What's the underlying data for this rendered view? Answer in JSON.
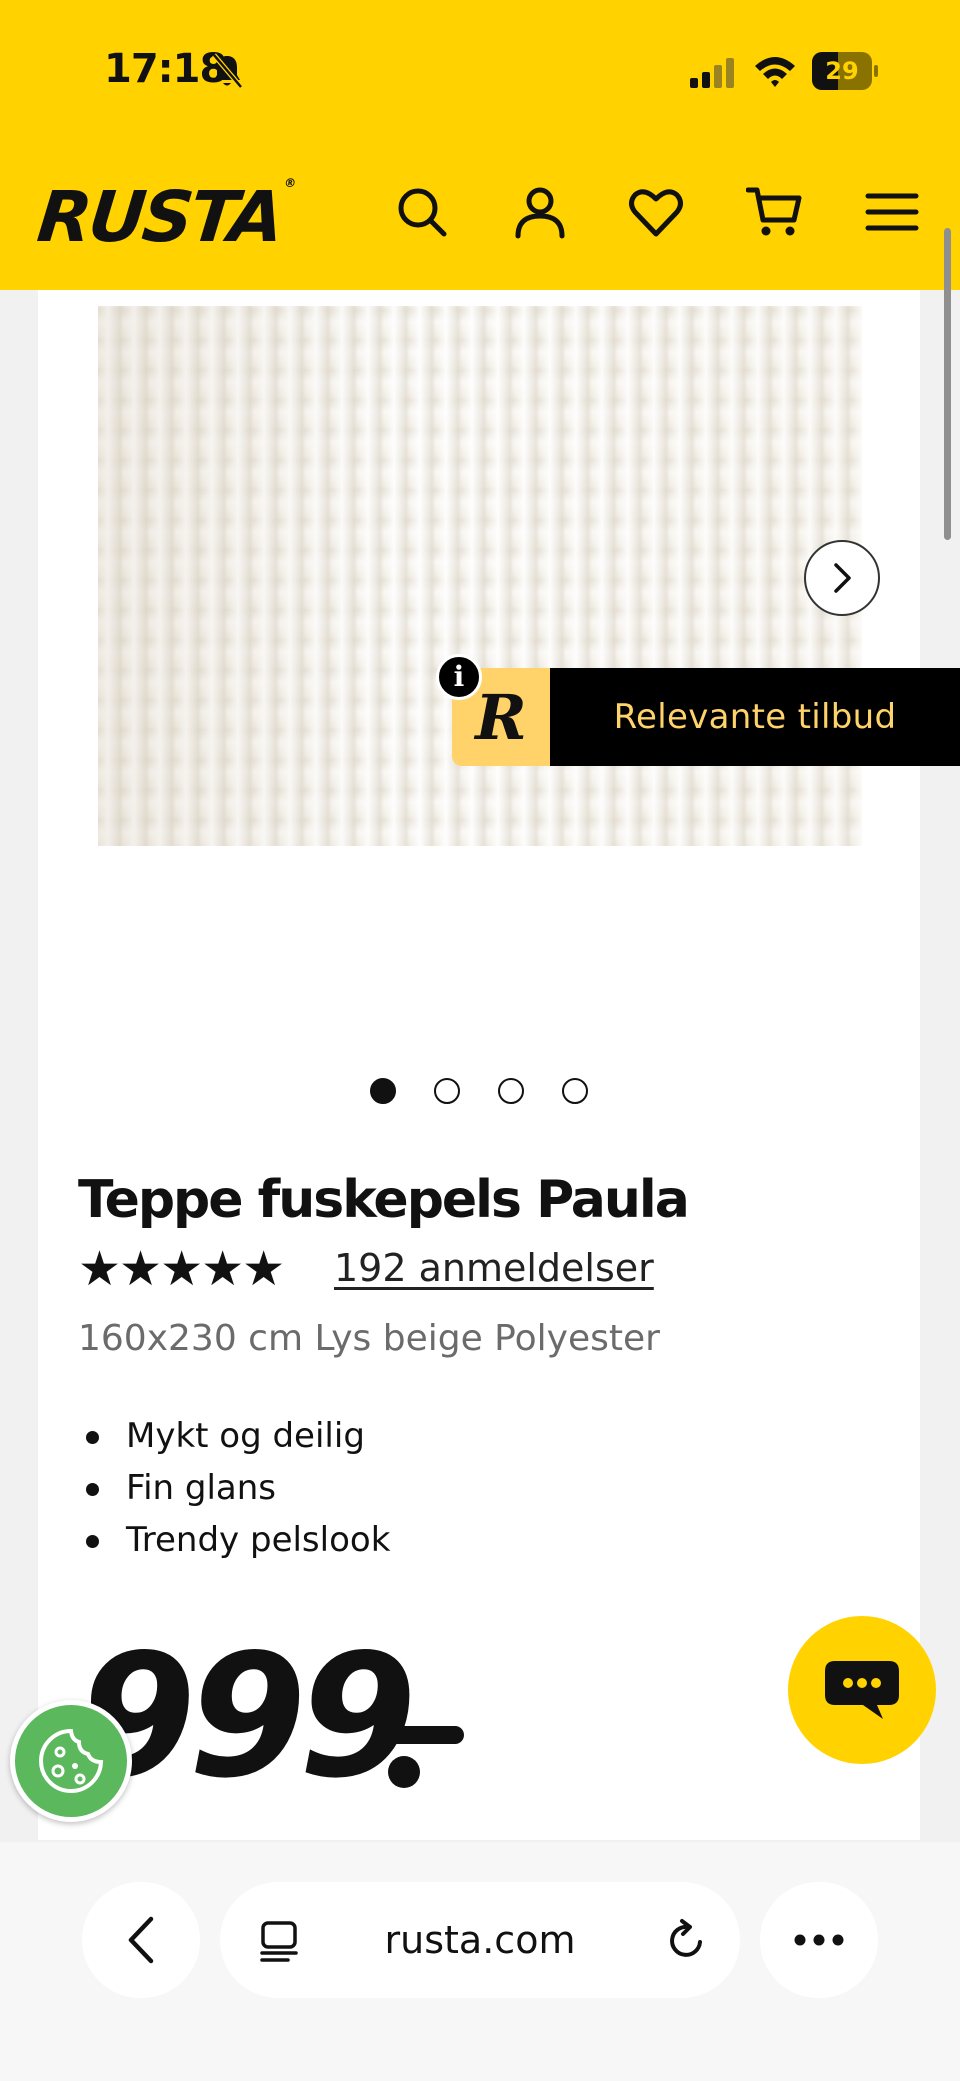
{
  "status_bar": {
    "time": "17:18",
    "battery": "29"
  },
  "header": {
    "logo": "RUSTA",
    "logo_mark": "®",
    "icons": [
      "search-icon",
      "account-icon",
      "heart-icon",
      "cart-icon",
      "menu-icon"
    ],
    "brand_color": "#ffd200"
  },
  "gallery": {
    "image_count": 4,
    "active_index": 0,
    "offers_badge_letter": "R",
    "offers_label": "Relevante tilbud",
    "info_label": "i"
  },
  "product": {
    "title": "Teppe fuskepels Paula",
    "stars": "★★★★★",
    "rating": 5,
    "reviews": "192 anmeldelser",
    "variant": "160x230 cm Lys beige Polyester",
    "features": [
      "Mykt og deilig",
      "Fin glans",
      "Trendy pelslook"
    ],
    "price": "999"
  },
  "browser": {
    "url": "rusta.com"
  }
}
